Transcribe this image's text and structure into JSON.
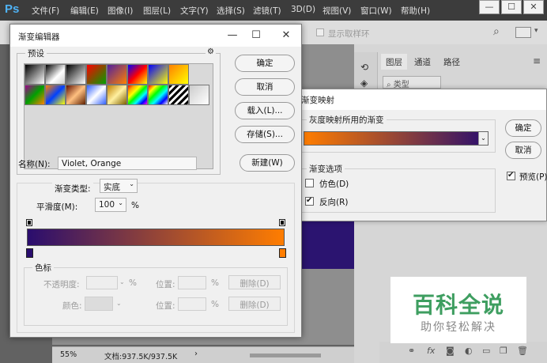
{
  "ps": {
    "logo": "Ps",
    "menu": [
      "文件(F)",
      "编辑(E)",
      "图像(I)",
      "图层(L)",
      "文字(Y)",
      "选择(S)",
      "滤镜(T)",
      "3D(D)",
      "视图(V)",
      "窗口(W)",
      "帮助(H)"
    ],
    "option_checkbox": "显示取样环",
    "panel_tabs": [
      "图层",
      "通道",
      "路径"
    ],
    "layer_filter": "类型",
    "status_zoom": "55%",
    "status_doc": "文档:937.5K/937.5K",
    "win_controls": [
      "—",
      "☐",
      "✕"
    ]
  },
  "watermark": {
    "title": "百科全说",
    "subtitle": "助你轻松解决"
  },
  "gradient_map": {
    "title": "渐变映射",
    "group_gradient": "灰度映射所用的渐变",
    "ok": "确定",
    "cancel": "取消",
    "preview": "预览(P)",
    "group_options": "渐变选项",
    "dither": "仿色(D)",
    "reverse": "反向(R)"
  },
  "gradient_editor": {
    "title": "渐变编辑器",
    "presets_label": "预设",
    "gear": "⚙",
    "buttons": {
      "ok": "确定",
      "cancel": "取消",
      "load": "载入(L)...",
      "save": "存储(S)...",
      "new": "新建(W)"
    },
    "name_label": "名称(N):",
    "name_value": "Violet, Orange",
    "type_label": "渐变类型:",
    "type_value": "实底",
    "smooth_label": "平滑度(M):",
    "smooth_value": "100",
    "smooth_unit": "%",
    "stops_group": "色标",
    "opacity_label": "不透明度:",
    "percent": "%",
    "position_label": "位置:",
    "delete_label": "删除(D)",
    "color_label": "颜色:",
    "gradient_start": "#2a0d6e",
    "gradient_end": "#ff7d00"
  }
}
